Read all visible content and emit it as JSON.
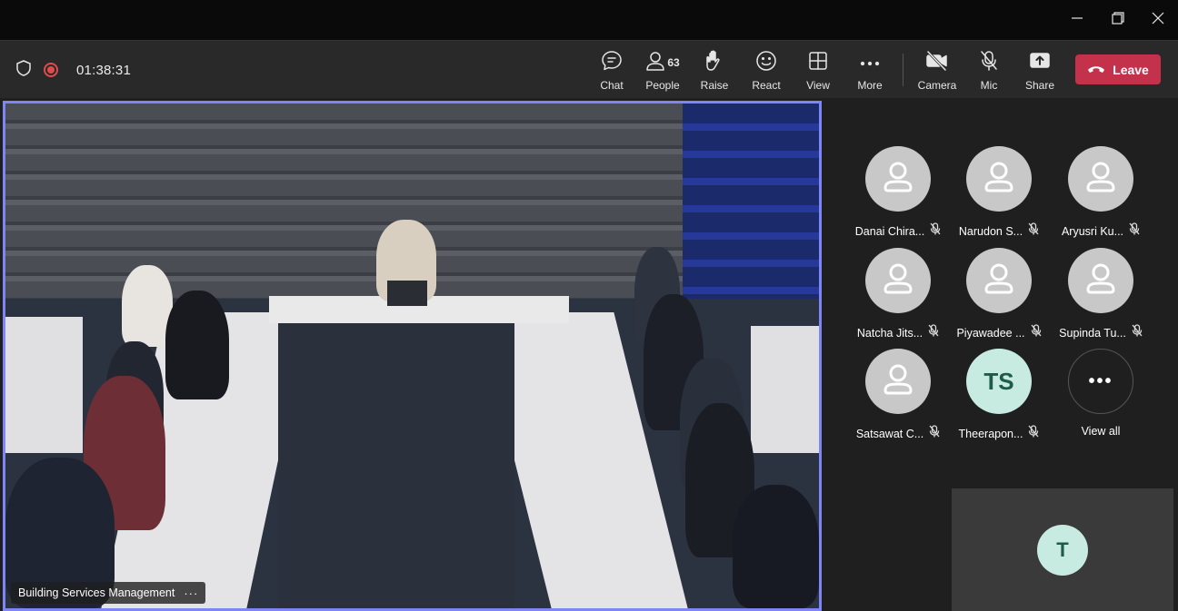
{
  "window": {
    "minimize_icon": "minimize-icon",
    "restore_icon": "restore-icon",
    "close_icon": "close-icon"
  },
  "meeting": {
    "recording_timer": "01:38:31",
    "recording_color": "#e04b4b"
  },
  "toolbar": {
    "chat_label": "Chat",
    "people_label": "People",
    "people_count": "63",
    "raise_label": "Raise",
    "react_label": "React",
    "view_label": "View",
    "more_label": "More",
    "camera_label": "Camera",
    "mic_label": "Mic",
    "share_label": "Share",
    "leave_label": "Leave",
    "leave_color": "#c4314b"
  },
  "stage": {
    "participant_name": "Building Services Management",
    "more_options": "···",
    "highlight_color": "#7f85f5"
  },
  "participants": [
    {
      "name": "Danai Chira...",
      "muted": true
    },
    {
      "name": "Narudon S...",
      "muted": true
    },
    {
      "name": "Aryusri Ku...",
      "muted": true
    },
    {
      "name": "Natcha Jits...",
      "muted": true
    },
    {
      "name": "Piyawadee ...",
      "muted": true
    },
    {
      "name": "Supinda Tu...",
      "muted": true
    },
    {
      "name": "Satsawat C...",
      "muted": true
    },
    {
      "name": "Theerapon...",
      "initials": "TS",
      "muted": true
    },
    {
      "name": "View all",
      "more": "•••"
    }
  ],
  "self_view": {
    "initials": "T"
  }
}
